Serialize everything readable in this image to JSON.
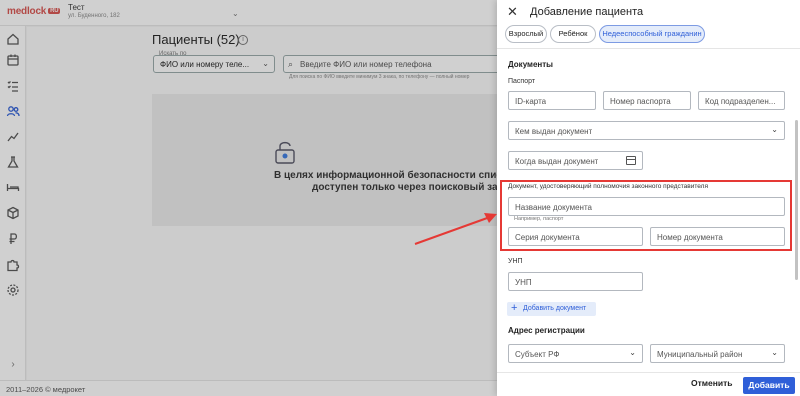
{
  "header": {
    "logo": "medlock",
    "logo_badge": "RU",
    "clinic_name": "Тест",
    "clinic_address": "ул. Буденного, 182"
  },
  "sidebar": {
    "icons": [
      "home-icon",
      "calendar-icon",
      "checklist-icon",
      "patients-icon",
      "chart-icon",
      "flask-icon",
      "bed-icon",
      "box-icon",
      "ruble-icon",
      "puzzle-icon",
      "settings-icon"
    ],
    "expand_icon": "chevron-right-icon"
  },
  "main": {
    "title": "Пациенты (52)",
    "search_by_label": "Искать по",
    "search_by_value": "ФИО или номеру теле...",
    "search_placeholder": "Введите ФИО или номер телефона",
    "search_hint": "Для поиска по ФИО введите минимум 3 знака, по телефону — полный номер",
    "info_line1": "В целях информационной безопасности список",
    "info_line2": "доступен только через поисковый запр"
  },
  "footer": {
    "text": "2011–2026 © медрокет"
  },
  "drawer": {
    "title": "Добавление пациента",
    "tabs": [
      "Взрослый",
      "Ребёнок",
      "Недееспособный гражданин"
    ],
    "active_tab": "Недееспособный гражданин",
    "documents_heading": "Документы",
    "passport_label": "Паспорт",
    "passport_fields": [
      "ID-карта",
      "Номер паспорта",
      "Код подразделен..."
    ],
    "issued_by": "Кем выдан документ",
    "issued_date": "Когда выдан документ",
    "rep_doc_label": "Документ, удостоверяющий полномочия законного представителя",
    "rep_doc_name": "Название документа",
    "rep_doc_hint": "Например, паспорт",
    "rep_doc_series": "Серия документа",
    "rep_doc_number": "Номер документа",
    "unp_label": "УНП",
    "unp_placeholder": "УНП",
    "add_document": "Добавить документ",
    "address_heading": "Адрес регистрации",
    "region": "Субъект РФ",
    "district": "Муниципальный район",
    "cancel": "Отменить",
    "submit": "Добавить"
  },
  "colors": {
    "accent": "#2f5fd8",
    "highlight": "#e53935",
    "brand": "#d9534f"
  }
}
